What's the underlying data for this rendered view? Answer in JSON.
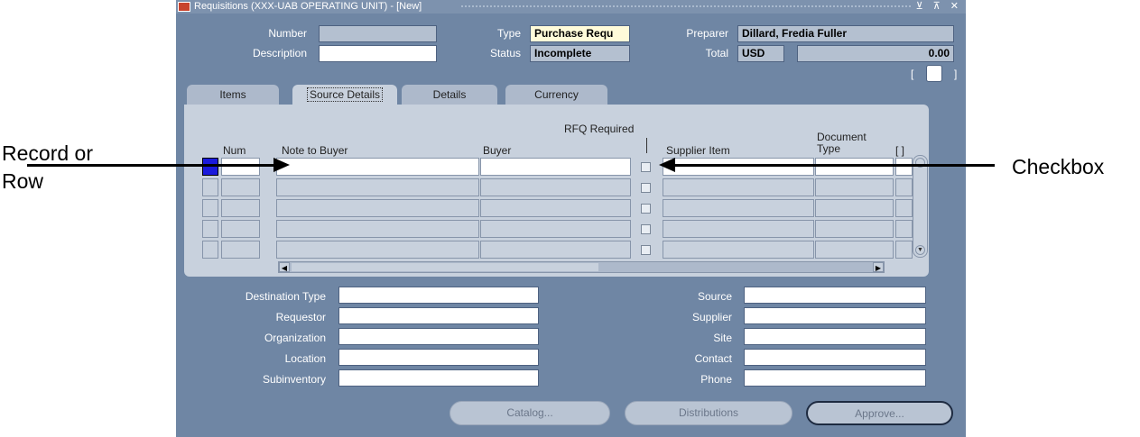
{
  "window": {
    "title": "Requisitions (XXX-UAB OPERATING UNIT) - [New]",
    "controls": "⊻ ⊼ ✕"
  },
  "header": {
    "number_label": "Number",
    "number_value": "",
    "type_label": "Type",
    "type_value": "Purchase Requ",
    "preparer_label": "Preparer",
    "preparer_value": "Dillard, Fredia Fuller",
    "description_label": "Description",
    "description_value": "",
    "status_label": "Status",
    "status_value": "Incomplete",
    "total_label": "Total",
    "currency_value": "USD",
    "total_value": "0.00",
    "bracket_left": "[",
    "bracket_right": "]"
  },
  "tabs": [
    {
      "label": "Items"
    },
    {
      "label": "Source Details"
    },
    {
      "label": "Details"
    },
    {
      "label": "Currency"
    }
  ],
  "grid": {
    "columns": {
      "num": "Num",
      "note": "Note to Buyer",
      "buyer": "Buyer",
      "rfq": "RFQ Required",
      "supplier_item": "Supplier Item",
      "doc_type_line1": "Document",
      "doc_type_line2": "Type",
      "flex": "[ ]"
    }
  },
  "lower": {
    "destination_type_label": "Destination Type",
    "requestor_label": "Requestor",
    "organization_label": "Organization",
    "location_label": "Location",
    "subinventory_label": "Subinventory",
    "source_label": "Source",
    "supplier_label": "Supplier",
    "site_label": "Site",
    "contact_label": "Contact",
    "phone_label": "Phone"
  },
  "buttons": {
    "catalog": "Catalog...",
    "distributions": "Distributions",
    "approve": "Approve..."
  },
  "annotations": {
    "record_line1": "Record or",
    "record_line2": "Row",
    "checkbox": "Checkbox"
  }
}
